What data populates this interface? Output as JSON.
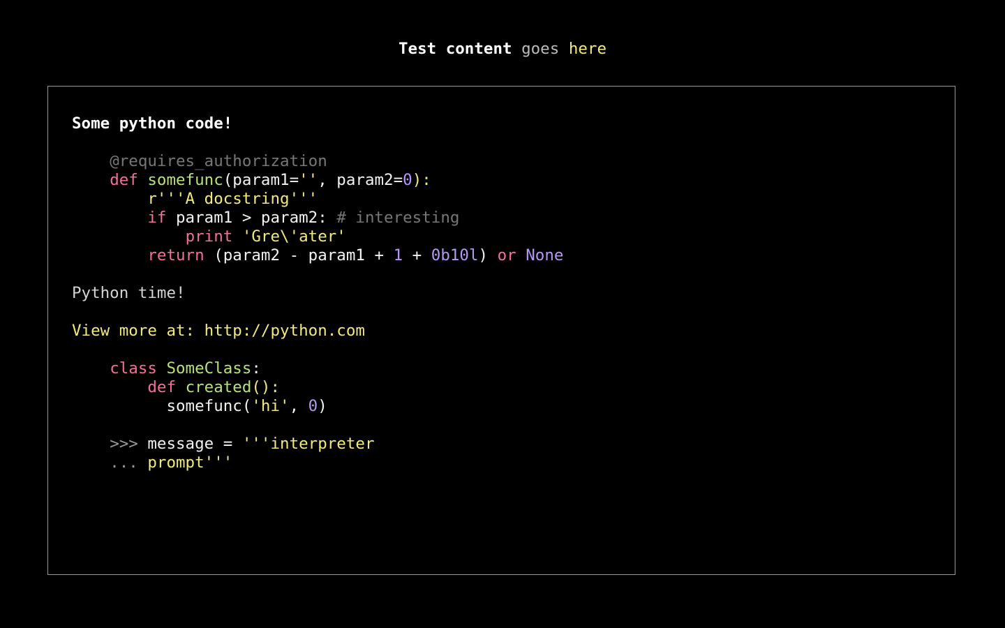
{
  "header": {
    "title_part1": "Test content",
    "title_part2": "goes",
    "title_part3": "here"
  },
  "content": {
    "heading": "Some python code!",
    "code_block_1": [
      [
        {
          "t": "    "
        },
        {
          "t": "@requires_authorization",
          "c": "decorator"
        }
      ],
      [
        {
          "t": "    "
        },
        {
          "t": "def",
          "c": "keyword"
        },
        {
          "t": " "
        },
        {
          "t": "somefunc",
          "c": "funcname"
        },
        {
          "t": "(param1=",
          "c": "text"
        },
        {
          "t": "''",
          "c": "string"
        },
        {
          "t": ", param2=",
          "c": "text"
        },
        {
          "t": "0",
          "c": "number"
        },
        {
          "t": "):",
          "c": "punct"
        }
      ],
      [
        {
          "t": "        "
        },
        {
          "t": "r'''A docstring'''",
          "c": "string"
        }
      ],
      [
        {
          "t": "        "
        },
        {
          "t": "if",
          "c": "keyword"
        },
        {
          "t": " param1 > param2: ",
          "c": "text"
        },
        {
          "t": "# interesting",
          "c": "comment"
        }
      ],
      [
        {
          "t": "            "
        },
        {
          "t": "print",
          "c": "keyword"
        },
        {
          "t": " "
        },
        {
          "t": "'Gre\\'ater'",
          "c": "string"
        }
      ],
      [
        {
          "t": "        "
        },
        {
          "t": "return",
          "c": "keyword"
        },
        {
          "t": " (param2 - param1 + ",
          "c": "text"
        },
        {
          "t": "1",
          "c": "number"
        },
        {
          "t": " + ",
          "c": "text"
        },
        {
          "t": "0b10l",
          "c": "number"
        },
        {
          "t": ") ",
          "c": "text"
        },
        {
          "t": "or",
          "c": "keyword"
        },
        {
          "t": " "
        },
        {
          "t": "None",
          "c": "number"
        }
      ]
    ],
    "paragraph": "Python time!",
    "link_line": "View more at: http://python.com",
    "code_block_2": [
      [
        {
          "t": "    "
        },
        {
          "t": "class",
          "c": "keyword"
        },
        {
          "t": " "
        },
        {
          "t": "SomeClass",
          "c": "classname"
        },
        {
          "t": ":",
          "c": "text"
        }
      ],
      [
        {
          "t": "        "
        },
        {
          "t": "def",
          "c": "keyword"
        },
        {
          "t": " "
        },
        {
          "t": "created",
          "c": "funcname"
        },
        {
          "t": "():",
          "c": "punct"
        }
      ],
      [
        {
          "t": "          "
        },
        {
          "t": "somefunc(",
          "c": "text"
        },
        {
          "t": "'hi'",
          "c": "string"
        },
        {
          "t": ", ",
          "c": "text"
        },
        {
          "t": "0",
          "c": "number"
        },
        {
          "t": ")",
          "c": "text"
        }
      ]
    ],
    "code_block_3": [
      [
        {
          "t": "    "
        },
        {
          "t": ">>>",
          "c": "prompt"
        },
        {
          "t": " message = ",
          "c": "text"
        },
        {
          "t": "'''interpreter",
          "c": "string"
        }
      ],
      [
        {
          "t": "    "
        },
        {
          "t": "...",
          "c": "prompt"
        },
        {
          "t": " "
        },
        {
          "t": "prompt'''",
          "c": "string"
        }
      ]
    ]
  }
}
